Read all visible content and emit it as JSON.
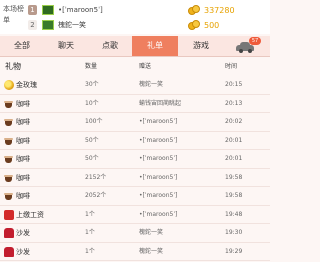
{
  "leaderboard": {
    "label": "本场榜单",
    "entries": [
      {
        "rank": "1",
        "name": "•[ˈmaroon5ˈ]",
        "score": "337280"
      },
      {
        "rank": "2",
        "name": "槐鉈一笑",
        "score": "500"
      }
    ]
  },
  "tabs": [
    {
      "label": "全部",
      "active": false
    },
    {
      "label": "聊天",
      "active": false
    },
    {
      "label": "点歌",
      "active": false
    },
    {
      "label": "礼单",
      "active": true
    },
    {
      "label": "游戏",
      "active": false
    }
  ],
  "car_badge": "57",
  "table": {
    "headers": {
      "gift": "礼物",
      "qty": "数量",
      "to": "赠送",
      "time": "时间"
    },
    "rows": [
      {
        "icon": "rose",
        "name": "金玫瑰",
        "qty": "30个",
        "to": "槐鉈一笑",
        "time": "20:15"
      },
      {
        "icon": "coffee",
        "name": "咖啡",
        "qty": "10个",
        "to": "蝓钱宙回蔺眺起",
        "time": "20:13"
      },
      {
        "icon": "coffee",
        "name": "咖啡",
        "qty": "100个",
        "to": "•[ˈmaroon5ˈ]",
        "time": "20:02"
      },
      {
        "icon": "coffee",
        "name": "咖啡",
        "qty": "50个",
        "to": "•[ˈmaroon5ˈ]",
        "time": "20:01"
      },
      {
        "icon": "coffee",
        "name": "咖啡",
        "qty": "50个",
        "to": "•[ˈmaroon5ˈ]",
        "time": "20:01"
      },
      {
        "icon": "coffee",
        "name": "咖啡",
        "qty": "2152个",
        "to": "•[ˈmaroon5ˈ]",
        "time": "19:58"
      },
      {
        "icon": "coffee",
        "name": "咖啡",
        "qty": "2052个",
        "to": "•[ˈmaroon5ˈ]",
        "time": "19:58"
      },
      {
        "icon": "salary",
        "name": "上缴工资",
        "qty": "1个",
        "to": "•[ˈmaroon5ˈ]",
        "time": "19:48"
      },
      {
        "icon": "sofa",
        "name": "沙发",
        "qty": "1个",
        "to": "槐鉈一笑",
        "time": "19:30"
      },
      {
        "icon": "sofa",
        "name": "沙发",
        "qty": "1个",
        "to": "槐鉈一笑",
        "time": "19:29"
      }
    ]
  }
}
